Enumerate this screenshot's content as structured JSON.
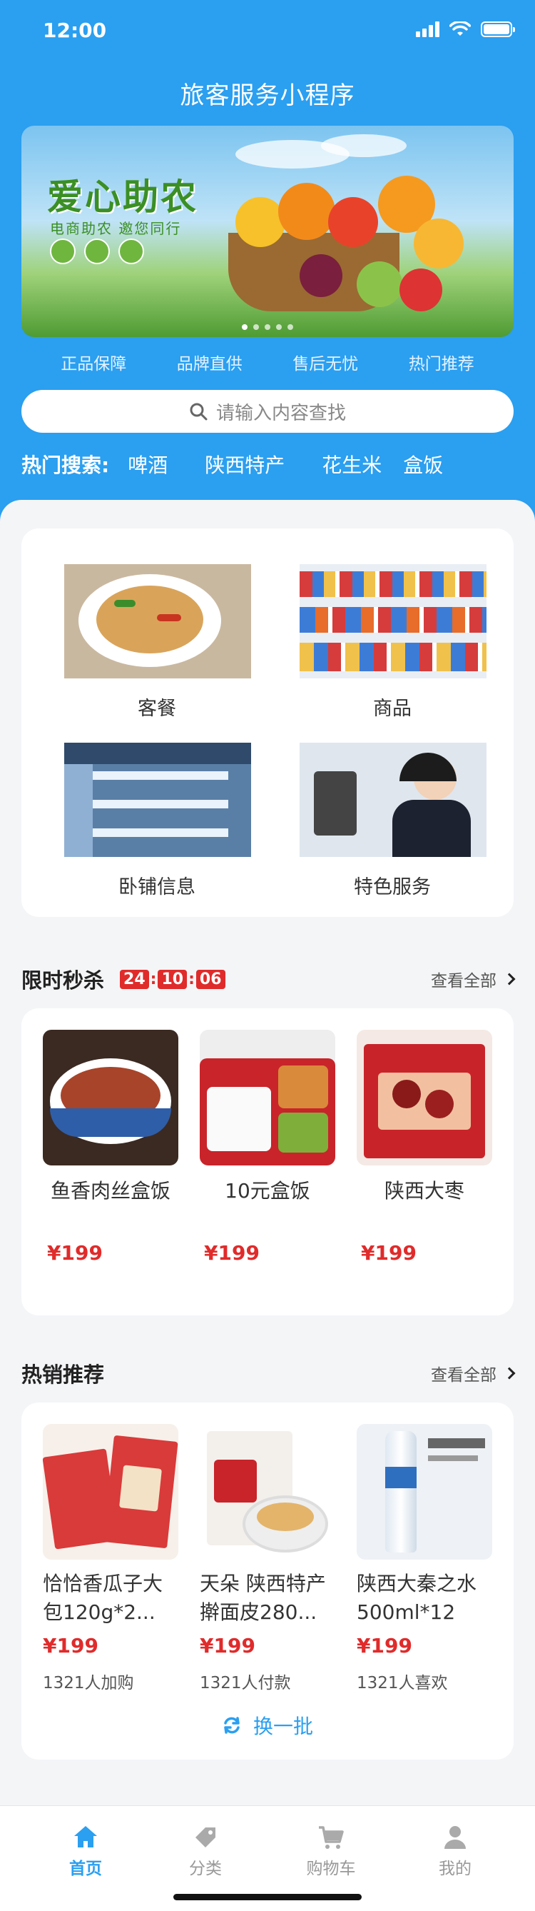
{
  "status_bar": {
    "time": "12:00"
  },
  "app_title": "旅客服务小程序",
  "banner": {
    "title": "爱心助农",
    "subtitle": "电商助农 邀您同行",
    "slide_count": 5,
    "active_slide": 1
  },
  "features": [
    "正品保障",
    "品牌直供",
    "售后无忧",
    "热门推荐"
  ],
  "search": {
    "placeholder": "请输入内容查找"
  },
  "hot_search": {
    "label": "热门搜索:",
    "words": [
      "啤酒",
      "陕西特产",
      "花生米",
      "盒饭"
    ]
  },
  "categories": [
    {
      "label": "客餐",
      "icon": "noodle-dish-image"
    },
    {
      "label": "商品",
      "icon": "store-shelf-image"
    },
    {
      "label": "卧铺信息",
      "icon": "sleeper-berth-image"
    },
    {
      "label": "特色服务",
      "icon": "attendant-service-image"
    }
  ],
  "flash_sale": {
    "title": "限时秒杀",
    "countdown": {
      "hours": "24",
      "minutes": "10",
      "seconds": "06"
    },
    "view_all": "查看全部",
    "products": [
      {
        "name": "鱼香肉丝盒饭",
        "price": "¥199"
      },
      {
        "name": "10元盒饭",
        "price": "¥199"
      },
      {
        "name": "陕西大枣",
        "price": "¥199"
      }
    ]
  },
  "hot_sale": {
    "title": "热销推荐",
    "view_all": "查看全部",
    "products": [
      {
        "name": "恰恰香瓜子大包120g*2...",
        "price": "¥199",
        "stat": "1321人加购"
      },
      {
        "name": "天朵 陕西特产擀面皮280...",
        "price": "¥199",
        "stat": "1321人付款"
      },
      {
        "name": "陕西大秦之水500ml*12",
        "price": "¥199",
        "stat": "1321人喜欢"
      }
    ],
    "refresh_label": "换一批"
  },
  "tabbar": [
    {
      "label": "首页",
      "icon": "home-icon",
      "active": true
    },
    {
      "label": "分类",
      "icon": "tag-icon",
      "active": false
    },
    {
      "label": "购物车",
      "icon": "cart-icon",
      "active": false
    },
    {
      "label": "我的",
      "icon": "user-icon",
      "active": false
    }
  ],
  "colors": {
    "primary": "#2b9ff0",
    "price": "#e02b2b",
    "background": "#f4f5f7"
  }
}
